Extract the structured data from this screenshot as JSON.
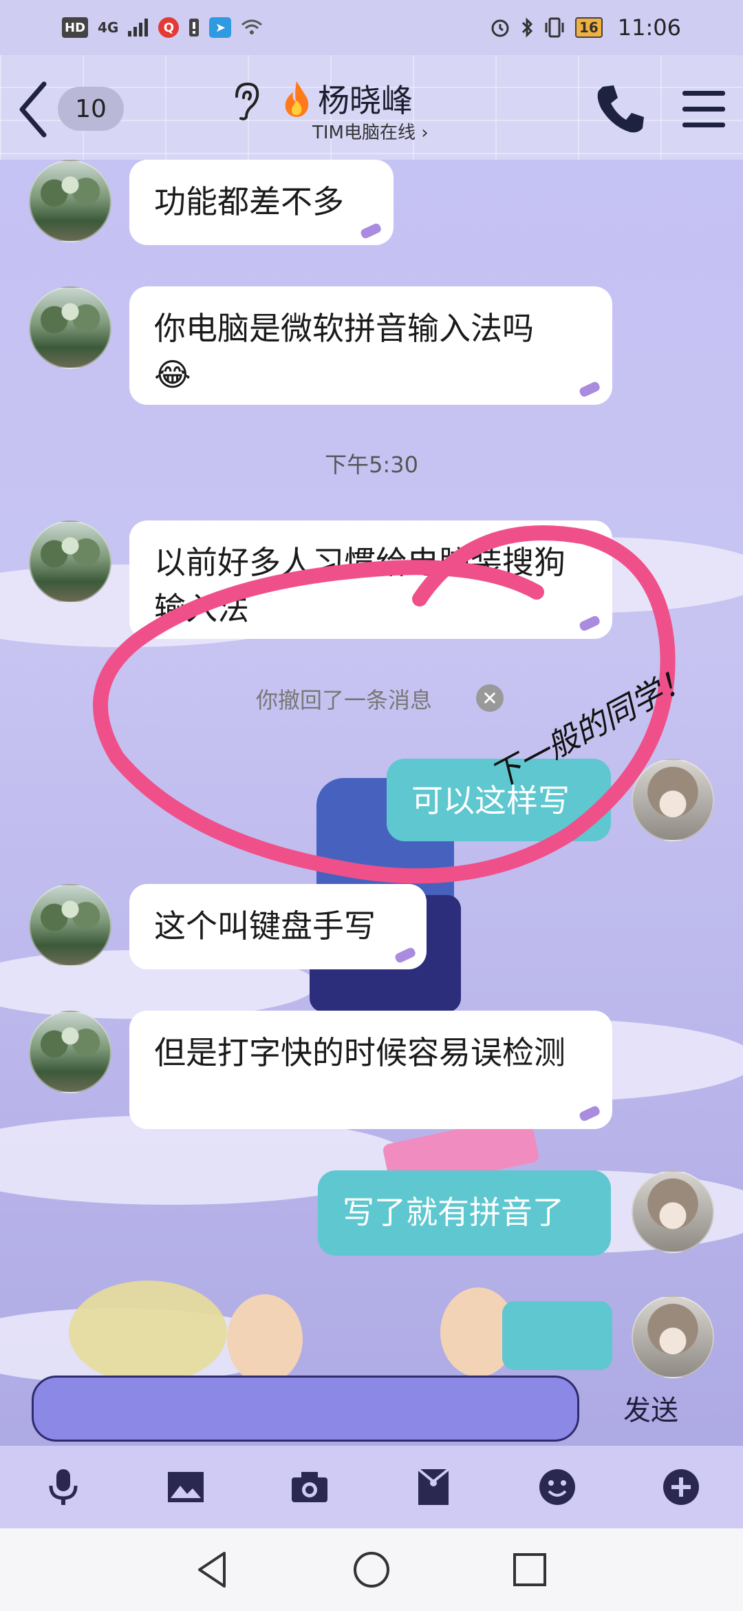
{
  "status_bar": {
    "hd": "HD",
    "network": "4G",
    "battery": "16",
    "time": "11:06"
  },
  "header": {
    "unread_count": "10",
    "contact_name": "杨晓峰",
    "contact_status": "TIM电脑在线 ›"
  },
  "messages": [
    {
      "side": "left",
      "text": "功能都差不多"
    },
    {
      "side": "left",
      "text": "你电脑是微软拼音输入法吗",
      "emoji": "😂"
    },
    {
      "side": "left",
      "text": "以前好多人习惯给电脑装搜狗输入法"
    },
    {
      "side": "right",
      "text": "可以这样写"
    },
    {
      "side": "left",
      "text": "这个叫键盘手写"
    },
    {
      "side": "left",
      "text": "但是打字快的时候容易误检测"
    },
    {
      "side": "right",
      "text": "写了就有拼音了"
    }
  ],
  "time_divider": "下午5:30",
  "recall_notice": "你撤回了一条消息",
  "handwriting_note": "下一般的同学！",
  "input": {
    "send_label": "发送"
  },
  "toolbar_icons": [
    "microphone-icon",
    "image-icon",
    "camera-icon",
    "red-packet-icon",
    "emoji-icon",
    "plus-icon"
  ],
  "colors": {
    "my_bubble": "#5ec7cf",
    "annotation_circle": "#f0508a",
    "input_bg": "#8b88e6"
  }
}
